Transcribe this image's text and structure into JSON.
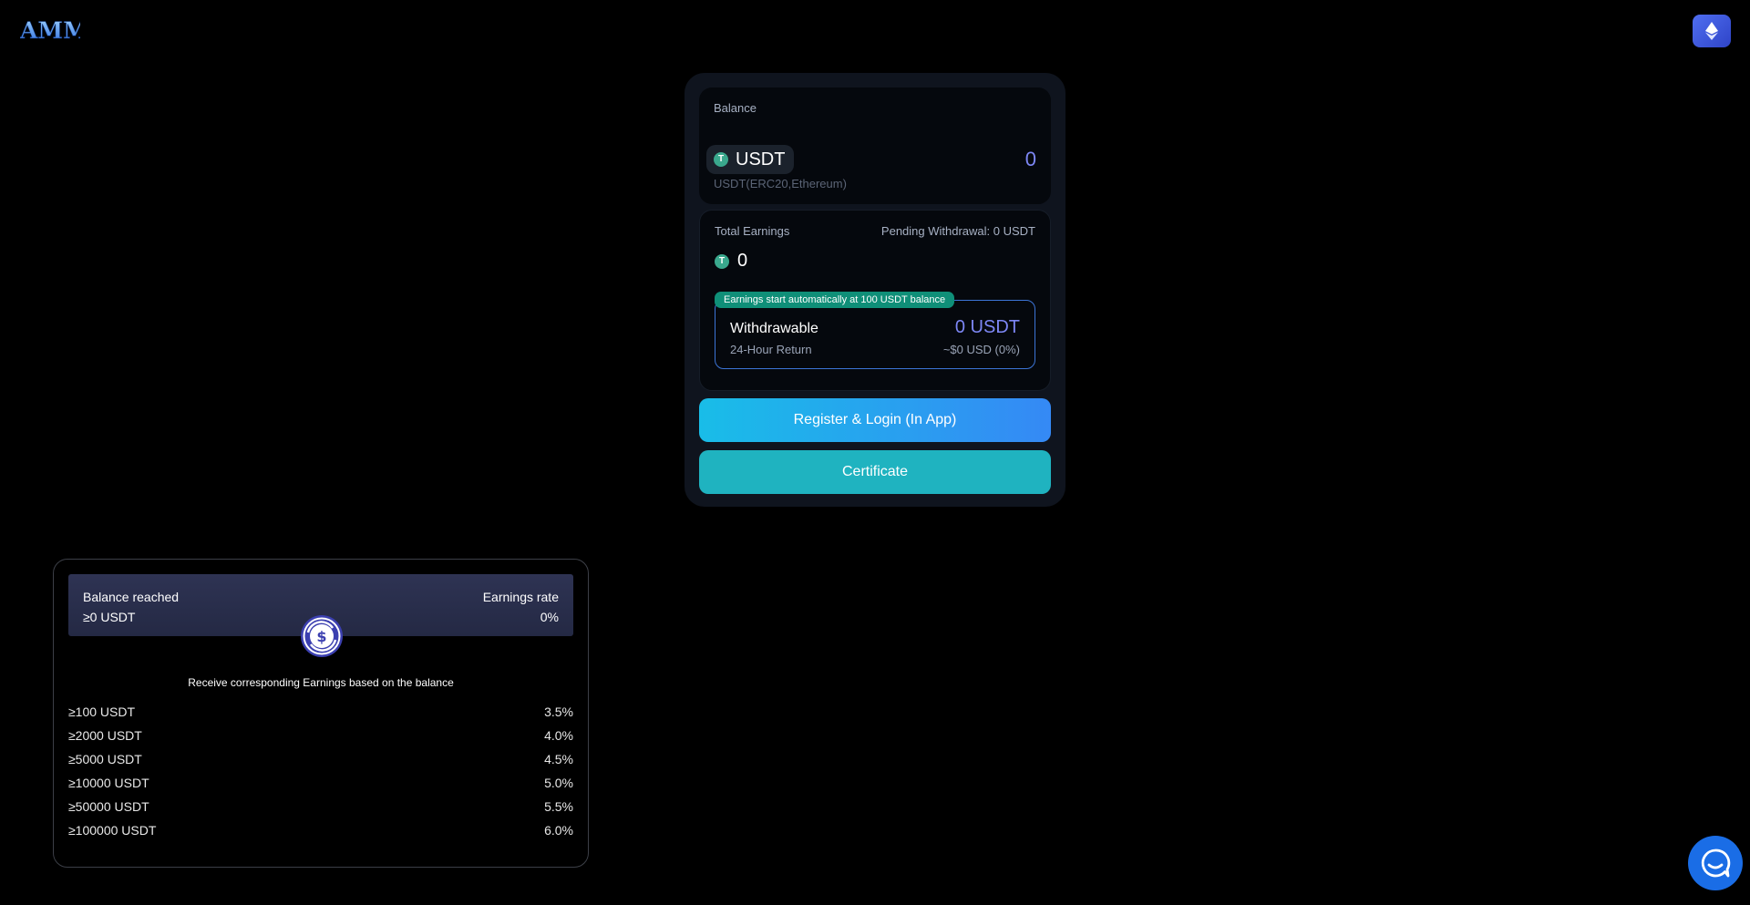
{
  "header": {
    "logo_text": "AMM",
    "network_icon": "ethereum-icon"
  },
  "balance": {
    "label": "Balance",
    "token": "USDT",
    "token_icon": "tether-icon",
    "value": "0",
    "network": "USDT(ERC20,Ethereum)"
  },
  "earnings": {
    "label": "Total Earnings",
    "pending": "Pending Withdrawal: 0 USDT",
    "value": "0",
    "auto_badge": "Earnings start automatically at 100 USDT balance",
    "withdrawable_label": "Withdrawable",
    "withdrawable_amount": "0 USDT",
    "return_label": "24-Hour Return",
    "return_value": "~$0 USD (0%)"
  },
  "actions": {
    "register_label": "Register & Login (In App)",
    "certificate_label": "Certificate"
  },
  "rates": {
    "head_left_title": "Balance reached",
    "head_left_value": "≥0 USDT",
    "head_right_title": "Earnings rate",
    "head_right_value": "0%",
    "note": "Receive corresponding Earnings based on the balance",
    "tiers": [
      {
        "threshold": "≥100 USDT",
        "rate": "3.5%"
      },
      {
        "threshold": "≥2000 USDT",
        "rate": "4.0%"
      },
      {
        "threshold": "≥5000 USDT",
        "rate": "4.5%"
      },
      {
        "threshold": "≥10000 USDT",
        "rate": "5.0%"
      },
      {
        "threshold": "≥50000 USDT",
        "rate": "5.5%"
      },
      {
        "threshold": "≥100000 USDT",
        "rate": "6.0%"
      }
    ]
  },
  "support": {
    "icon": "chat-icon"
  },
  "colors": {
    "accent": "#7d87f5",
    "badge_green": "#0f8f78",
    "register_gradient_start": "#19bde8",
    "register_gradient_end": "#3589f5",
    "certificate": "#1fb3c0"
  }
}
